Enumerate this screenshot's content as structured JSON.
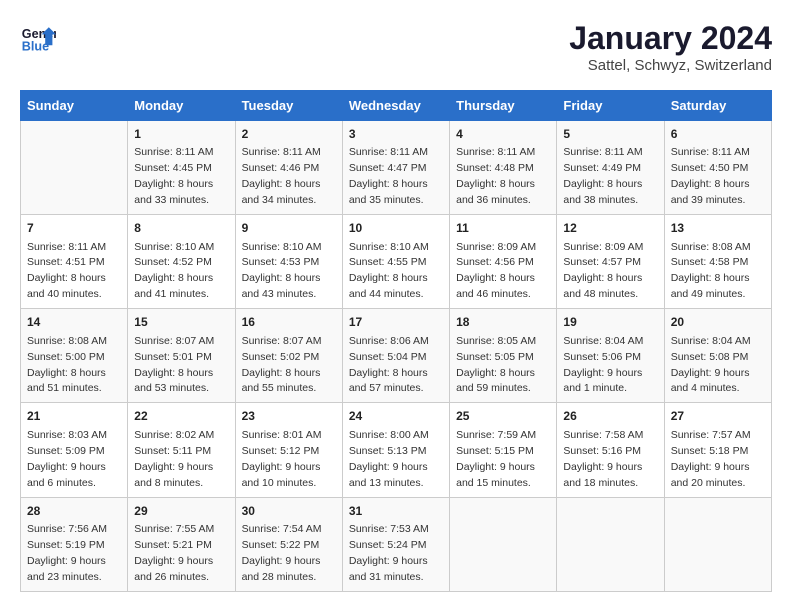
{
  "header": {
    "logo_line1": "General",
    "logo_line2": "Blue",
    "month": "January 2024",
    "location": "Sattel, Schwyz, Switzerland"
  },
  "weekdays": [
    "Sunday",
    "Monday",
    "Tuesday",
    "Wednesday",
    "Thursday",
    "Friday",
    "Saturday"
  ],
  "weeks": [
    [
      {
        "day": "",
        "detail": ""
      },
      {
        "day": "1",
        "detail": "Sunrise: 8:11 AM\nSunset: 4:45 PM\nDaylight: 8 hours\nand 33 minutes."
      },
      {
        "day": "2",
        "detail": "Sunrise: 8:11 AM\nSunset: 4:46 PM\nDaylight: 8 hours\nand 34 minutes."
      },
      {
        "day": "3",
        "detail": "Sunrise: 8:11 AM\nSunset: 4:47 PM\nDaylight: 8 hours\nand 35 minutes."
      },
      {
        "day": "4",
        "detail": "Sunrise: 8:11 AM\nSunset: 4:48 PM\nDaylight: 8 hours\nand 36 minutes."
      },
      {
        "day": "5",
        "detail": "Sunrise: 8:11 AM\nSunset: 4:49 PM\nDaylight: 8 hours\nand 38 minutes."
      },
      {
        "day": "6",
        "detail": "Sunrise: 8:11 AM\nSunset: 4:50 PM\nDaylight: 8 hours\nand 39 minutes."
      }
    ],
    [
      {
        "day": "7",
        "detail": "Sunrise: 8:11 AM\nSunset: 4:51 PM\nDaylight: 8 hours\nand 40 minutes."
      },
      {
        "day": "8",
        "detail": "Sunrise: 8:10 AM\nSunset: 4:52 PM\nDaylight: 8 hours\nand 41 minutes."
      },
      {
        "day": "9",
        "detail": "Sunrise: 8:10 AM\nSunset: 4:53 PM\nDaylight: 8 hours\nand 43 minutes."
      },
      {
        "day": "10",
        "detail": "Sunrise: 8:10 AM\nSunset: 4:55 PM\nDaylight: 8 hours\nand 44 minutes."
      },
      {
        "day": "11",
        "detail": "Sunrise: 8:09 AM\nSunset: 4:56 PM\nDaylight: 8 hours\nand 46 minutes."
      },
      {
        "day": "12",
        "detail": "Sunrise: 8:09 AM\nSunset: 4:57 PM\nDaylight: 8 hours\nand 48 minutes."
      },
      {
        "day": "13",
        "detail": "Sunrise: 8:08 AM\nSunset: 4:58 PM\nDaylight: 8 hours\nand 49 minutes."
      }
    ],
    [
      {
        "day": "14",
        "detail": "Sunrise: 8:08 AM\nSunset: 5:00 PM\nDaylight: 8 hours\nand 51 minutes."
      },
      {
        "day": "15",
        "detail": "Sunrise: 8:07 AM\nSunset: 5:01 PM\nDaylight: 8 hours\nand 53 minutes."
      },
      {
        "day": "16",
        "detail": "Sunrise: 8:07 AM\nSunset: 5:02 PM\nDaylight: 8 hours\nand 55 minutes."
      },
      {
        "day": "17",
        "detail": "Sunrise: 8:06 AM\nSunset: 5:04 PM\nDaylight: 8 hours\nand 57 minutes."
      },
      {
        "day": "18",
        "detail": "Sunrise: 8:05 AM\nSunset: 5:05 PM\nDaylight: 8 hours\nand 59 minutes."
      },
      {
        "day": "19",
        "detail": "Sunrise: 8:04 AM\nSunset: 5:06 PM\nDaylight: 9 hours\nand 1 minute."
      },
      {
        "day": "20",
        "detail": "Sunrise: 8:04 AM\nSunset: 5:08 PM\nDaylight: 9 hours\nand 4 minutes."
      }
    ],
    [
      {
        "day": "21",
        "detail": "Sunrise: 8:03 AM\nSunset: 5:09 PM\nDaylight: 9 hours\nand 6 minutes."
      },
      {
        "day": "22",
        "detail": "Sunrise: 8:02 AM\nSunset: 5:11 PM\nDaylight: 9 hours\nand 8 minutes."
      },
      {
        "day": "23",
        "detail": "Sunrise: 8:01 AM\nSunset: 5:12 PM\nDaylight: 9 hours\nand 10 minutes."
      },
      {
        "day": "24",
        "detail": "Sunrise: 8:00 AM\nSunset: 5:13 PM\nDaylight: 9 hours\nand 13 minutes."
      },
      {
        "day": "25",
        "detail": "Sunrise: 7:59 AM\nSunset: 5:15 PM\nDaylight: 9 hours\nand 15 minutes."
      },
      {
        "day": "26",
        "detail": "Sunrise: 7:58 AM\nSunset: 5:16 PM\nDaylight: 9 hours\nand 18 minutes."
      },
      {
        "day": "27",
        "detail": "Sunrise: 7:57 AM\nSunset: 5:18 PM\nDaylight: 9 hours\nand 20 minutes."
      }
    ],
    [
      {
        "day": "28",
        "detail": "Sunrise: 7:56 AM\nSunset: 5:19 PM\nDaylight: 9 hours\nand 23 minutes."
      },
      {
        "day": "29",
        "detail": "Sunrise: 7:55 AM\nSunset: 5:21 PM\nDaylight: 9 hours\nand 26 minutes."
      },
      {
        "day": "30",
        "detail": "Sunrise: 7:54 AM\nSunset: 5:22 PM\nDaylight: 9 hours\nand 28 minutes."
      },
      {
        "day": "31",
        "detail": "Sunrise: 7:53 AM\nSunset: 5:24 PM\nDaylight: 9 hours\nand 31 minutes."
      },
      {
        "day": "",
        "detail": ""
      },
      {
        "day": "",
        "detail": ""
      },
      {
        "day": "",
        "detail": ""
      }
    ]
  ]
}
